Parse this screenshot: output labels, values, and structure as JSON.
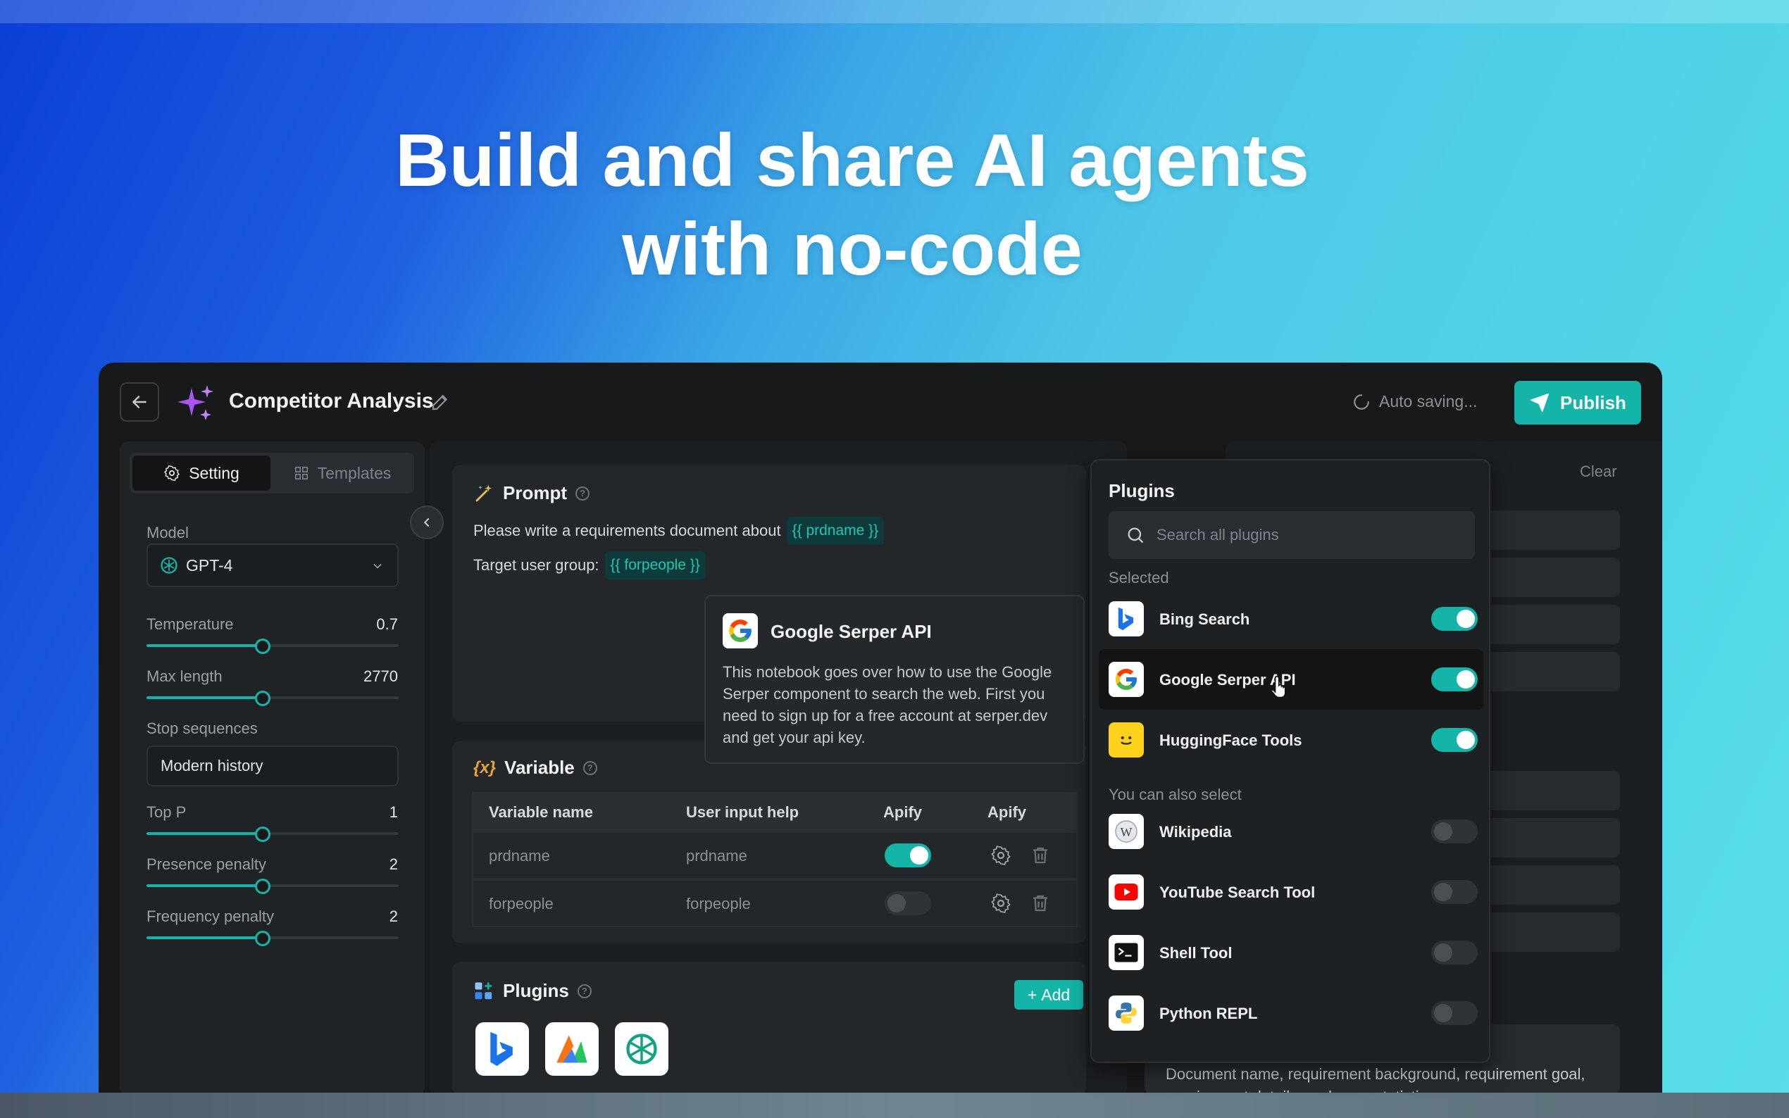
{
  "hero": {
    "line1": "Build and share AI agents",
    "line2": "with no-code"
  },
  "header": {
    "app_title": "Competitor Analysis",
    "autosave_text": "Auto saving...",
    "publish_label": "Publish"
  },
  "left_panel": {
    "tabs": [
      {
        "label": "Setting",
        "icon": "gear-icon",
        "active": true
      },
      {
        "label": "Templates",
        "icon": "grid-icon",
        "active": false
      }
    ],
    "model_label": "Model",
    "model_value": "GPT-4",
    "params": [
      {
        "label": "Temperature",
        "value": "0.7",
        "fraction": 0.46
      },
      {
        "label": "Max length",
        "value": "2770",
        "fraction": 0.46
      },
      {
        "label": "Stop sequences",
        "value": ""
      },
      {
        "label": "Top P",
        "value": "1",
        "fraction": 0.46
      },
      {
        "label": "Presence penalty",
        "value": "2",
        "fraction": 0.46
      },
      {
        "label": "Frequency penalty",
        "value": "2",
        "fraction": 0.46
      }
    ],
    "stop_sequence_value": "Modern history"
  },
  "prompt": {
    "title": "Prompt",
    "line1_text": "Please write a requirements document about",
    "line1_var": "{{ prdname }}",
    "line2_text": "Target user group:",
    "line2_var": "{{ forpeople }}"
  },
  "tooltip": {
    "title": "Google Serper API",
    "body": "This notebook goes over how to use the Google Serper component to search the web. First you need to sign up for a free account at serper.dev and get your api key."
  },
  "variable": {
    "title": "Variable",
    "icon_text": "{x}",
    "columns": [
      "Variable name",
      "User input help",
      "Apify",
      "Apify"
    ],
    "rows": [
      {
        "name": "prdname",
        "help": "prdname",
        "enabled": true
      },
      {
        "name": "forpeople",
        "help": "forpeople",
        "enabled": false
      }
    ]
  },
  "plugins_card": {
    "title": "Plugins",
    "add_label": "Add"
  },
  "right_panel": {
    "clear_label": "Clear",
    "text": "Document name, requirement background, requirement goal, requirement details, and page statistics"
  },
  "plugins_popover": {
    "title": "Plugins",
    "search_placeholder": "Search all plugins",
    "selected_label": "Selected",
    "others_label": "You can also select",
    "selected": [
      {
        "name": "Bing Search",
        "icon": "bing-icon",
        "enabled": true
      },
      {
        "name": "Google Serper API",
        "icon": "google-icon",
        "enabled": true
      },
      {
        "name": "HuggingFace Tools",
        "icon": "huggingface-icon",
        "enabled": true
      }
    ],
    "others": [
      {
        "name": "Wikipedia",
        "icon": "wikipedia-icon",
        "enabled": false
      },
      {
        "name": "YouTube Search Tool",
        "icon": "youtube-icon",
        "enabled": false
      },
      {
        "name": "Shell Tool",
        "icon": "terminal-icon",
        "enabled": false
      },
      {
        "name": "Python REPL",
        "icon": "python-icon",
        "enabled": false
      }
    ]
  },
  "colors": {
    "accent": "#14b5a8",
    "app_bg": "#17191b",
    "logo": "#a855f7"
  }
}
